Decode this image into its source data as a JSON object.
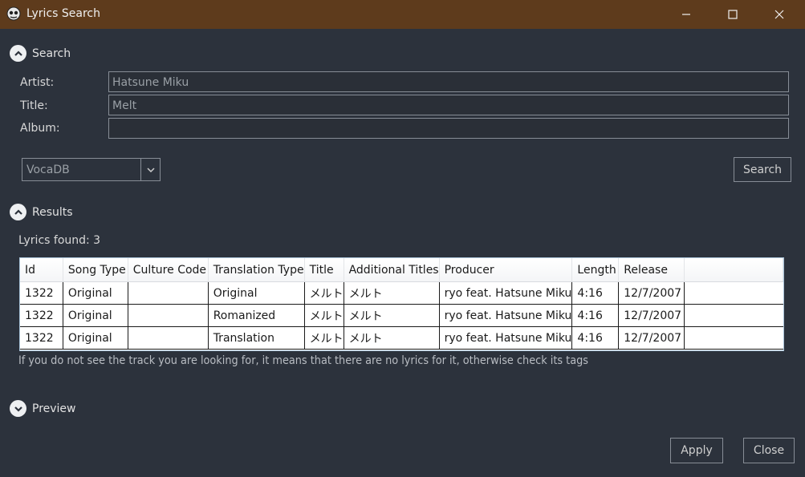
{
  "window": {
    "title": "Lyrics Search"
  },
  "search_section": {
    "label": "Search",
    "artist_label": "Artist:",
    "artist_value": "Hatsune Miku",
    "title_label": "Title:",
    "title_value": "Melt",
    "album_label": "Album:",
    "album_value": "",
    "source": "VocaDB",
    "search_button": "Search"
  },
  "results_section": {
    "label": "Results",
    "count_text": "Lyrics found: 3",
    "columns": [
      "Id",
      "Song Type",
      "Culture Code",
      "Translation Type",
      "Title",
      "Additional Titles",
      "Producer",
      "Length",
      "Release"
    ],
    "rows": [
      [
        "1322",
        "Original",
        "",
        "Original",
        "メルト",
        "メルト",
        "ryo feat. Hatsune Miku",
        "4:16",
        "12/7/2007"
      ],
      [
        "1322",
        "Original",
        "",
        "Romanized",
        "メルト",
        "メルト",
        "ryo feat. Hatsune Miku",
        "4:16",
        "12/7/2007"
      ],
      [
        "1322",
        "Original",
        "",
        "Translation",
        "メルト",
        "メルト",
        "ryo feat. Hatsune Miku",
        "4:16",
        "12/7/2007"
      ]
    ],
    "hint": "If you do not see the track you are looking for, it means that there are no lyrics for it, otherwise check its tags"
  },
  "preview_section": {
    "label": "Preview"
  },
  "footer": {
    "apply_button": "Apply",
    "close_button": "Close"
  },
  "icons": {
    "app": "foobar-icon",
    "minimize": "minimize-icon",
    "maximize": "maximize-icon",
    "close": "close-icon",
    "expanded": "chevron-up-icon",
    "collapsed": "chevron-down-icon",
    "dropdown": "chevron-down-icon"
  },
  "colors": {
    "titlebar": "#5e3b1c",
    "background": "#2c323c",
    "grid_border": "#a9c3d9"
  }
}
